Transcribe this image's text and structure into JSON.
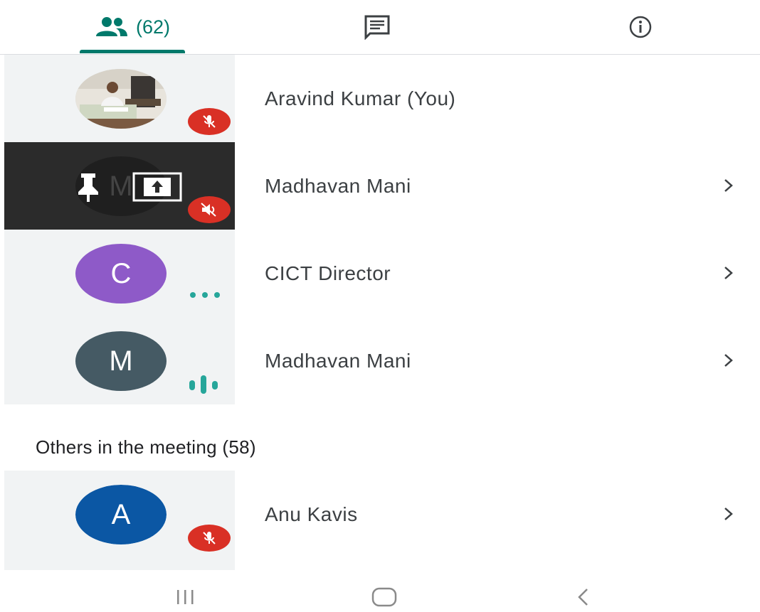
{
  "tabs": {
    "people_count": "(62)",
    "chat_icon": "chat-icon",
    "info_icon": "info-icon"
  },
  "pinned": [
    {
      "name": "Aravind Kumar (You)",
      "status": "muted",
      "avatar": "photo"
    },
    {
      "name": "Madhavan Mani",
      "status": "muted",
      "avatar": "M",
      "presenting": true
    },
    {
      "name": "CICT Director",
      "status": "connecting",
      "avatar": "C"
    },
    {
      "name": "Madhavan Mani",
      "status": "speaking",
      "avatar": "M"
    }
  ],
  "others": {
    "title": "Others in the meeting (58)",
    "items": [
      {
        "name": "Anu Kavis",
        "status": "muted",
        "avatar": "A"
      }
    ]
  },
  "colors": {
    "accent": "#00796b",
    "mute_badge": "#d93025",
    "avatar_c": "#8e5ac8",
    "avatar_m": "#455a64",
    "avatar_a": "#0b57a4"
  }
}
